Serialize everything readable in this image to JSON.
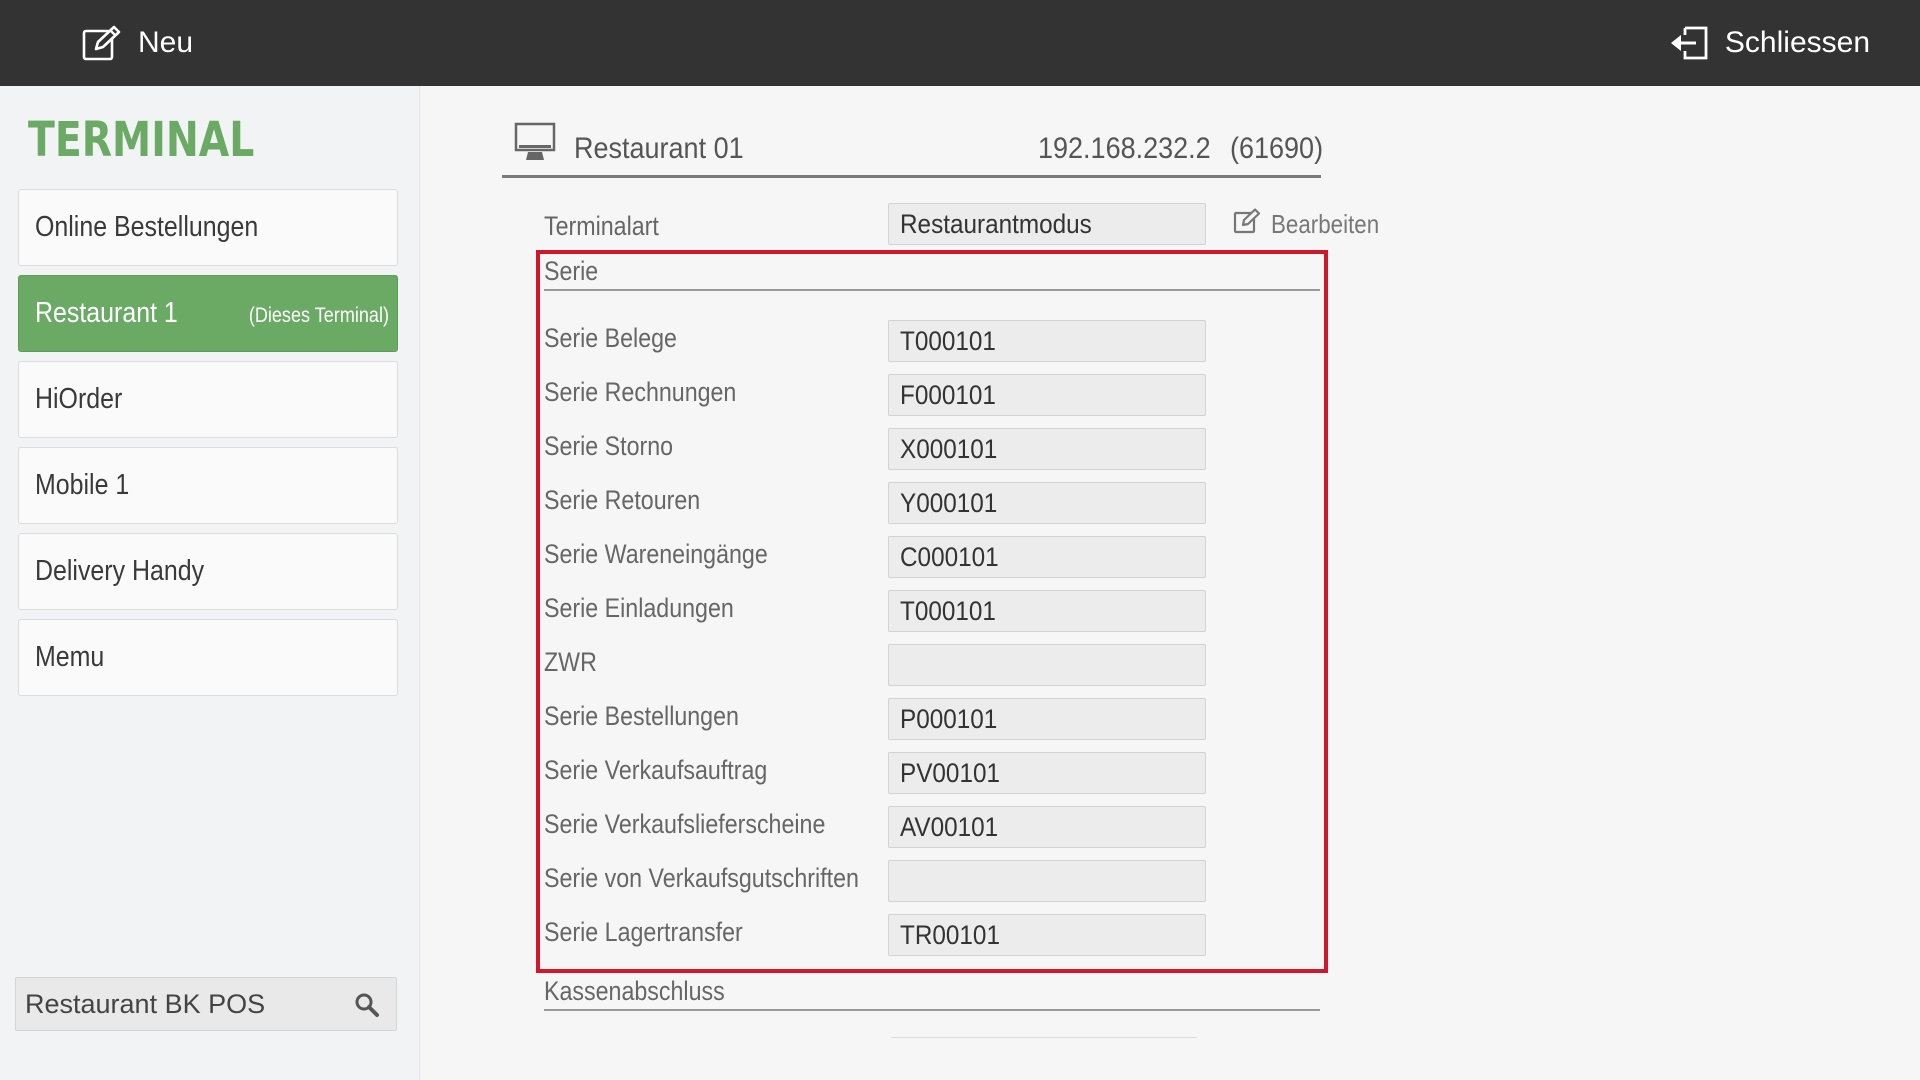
{
  "topbar": {
    "new_label": "Neu",
    "close_label": "Schliessen",
    "new_icon": "edit-icon",
    "close_icon": "exit-icon"
  },
  "sidebar": {
    "title": "TERMINAL",
    "items": [
      {
        "label": "Online Bestellungen",
        "sub": ""
      },
      {
        "label": "Restaurant 1",
        "sub": "(Dieses Terminal)",
        "active": true
      },
      {
        "label": "HiOrder",
        "sub": ""
      },
      {
        "label": "Mobile 1",
        "sub": ""
      },
      {
        "label": "Delivery Handy",
        "sub": ""
      },
      {
        "label": "Memu",
        "sub": ""
      }
    ],
    "search_value": "Restaurant BK POS"
  },
  "terminal": {
    "name": "Restaurant 01",
    "ip": "192.168.232.2",
    "port": "(61690)",
    "type_label": "Terminalart",
    "type_value": "Restaurantmodus",
    "edit_label": "Bearbeiten"
  },
  "serie": {
    "heading": "Serie",
    "rows": [
      {
        "label": "Serie Belege",
        "value": "T000101"
      },
      {
        "label": "Serie Rechnungen",
        "value": "F000101"
      },
      {
        "label": "Serie Storno",
        "value": "X000101"
      },
      {
        "label": "Serie Retouren",
        "value": "Y000101"
      },
      {
        "label": "Serie Wareneingänge",
        "value": "C000101"
      },
      {
        "label": "Serie Einladungen",
        "value": "T000101"
      },
      {
        "label": "ZWR",
        "value": ""
      },
      {
        "label": "Serie Bestellungen",
        "value": "P000101"
      },
      {
        "label": "Serie Verkaufsauftrag",
        "value": "PV00101"
      },
      {
        "label": "Serie Verkaufslieferscheine",
        "value": "AV00101"
      },
      {
        "label": "Serie von Verkaufsgutschriften",
        "value": ""
      },
      {
        "label": "Serie Lagertransfer",
        "value": "TR00101"
      }
    ]
  },
  "kassenabschluss": {
    "heading": "Kassenabschluss"
  },
  "colors": {
    "accent": "#6aaa64",
    "topbar": "#333333",
    "highlight": "#d0182d"
  }
}
